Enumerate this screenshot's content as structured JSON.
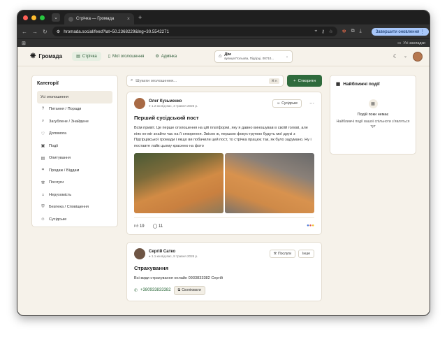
{
  "browser": {
    "tab_title": "Стрічка — Громада",
    "url": "hromada.social/feed?lat=50.2368229&lng=30.5542271",
    "update_button": "Завершити оновлення",
    "bookmarks_label": "Усі закладки"
  },
  "header": {
    "brand": "Громада",
    "nav": [
      {
        "label": "Стрічка",
        "icon": "feed-icon"
      },
      {
        "label": "Мої оголошення",
        "icon": "document-icon"
      },
      {
        "label": "Адмінка",
        "icon": "gear-icon"
      }
    ],
    "location": {
      "title": "Дім",
      "address": "вулиця Польова, Підгірці, 08710..."
    }
  },
  "categories": {
    "title": "Категорії",
    "items": [
      {
        "label": "Усі оголошення",
        "icon": ""
      },
      {
        "label": "Питання / Поради",
        "icon": "?"
      },
      {
        "label": "Загублене / Знайдене",
        "icon": "⌕"
      },
      {
        "label": "Допомога",
        "icon": "♡"
      },
      {
        "label": "Події",
        "icon": "▣"
      },
      {
        "label": "Опитування",
        "icon": "▤"
      },
      {
        "label": "Продаж / Віддам",
        "icon": "⌗"
      },
      {
        "label": "Послуги",
        "icon": "⚒"
      },
      {
        "label": "Нерухомість",
        "icon": "⌂"
      },
      {
        "label": "Безпека / Сповіщення",
        "icon": "⛨"
      },
      {
        "label": "Сусідське",
        "icon": "☺"
      }
    ]
  },
  "search": {
    "placeholder": "Шукати оголошення...",
    "shortcut": "⌘ K"
  },
  "create_button": "Створити",
  "posts": [
    {
      "author": "Олег Кузьменко",
      "meta": "1.2 км від вас, 3 травня 2026 р.",
      "badge": "Сусідське",
      "title": "Перший сусідський пост",
      "body": "Всім привіт. Це перше оголошення на цій платформі, яку я давно виношував в своїй голові, але ніяк не міг знайти час на її створення. Звісно ж, першою фокус-групою будуть мої друзі з Підгірцівської громади і якщо ви побачили цей пост, то стрічка працює так, як було задумано. Ну і поставте лайк цьому красеню на фото",
      "likes": "19",
      "comments": "11"
    },
    {
      "author": "Сергій Сатко",
      "meta": "1.1 км від вас, 8 травня 2026 р.",
      "badge": "Послуги",
      "badge2": "Інше",
      "title": "Страхування",
      "body": "Всі види страхування онлайн 0933833382 Сергій",
      "phone": "+380933833382",
      "copy": "Скопіювати"
    }
  ],
  "events": {
    "title": "Найближчі події",
    "empty": "Подій поки немає",
    "hint": "Найближчі події вашої спільноти з'являться тут"
  }
}
